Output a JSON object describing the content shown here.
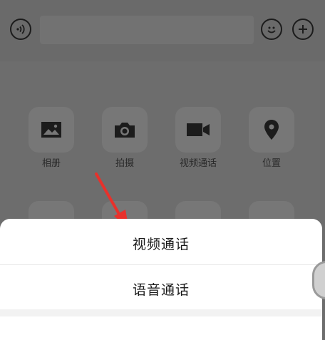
{
  "input_bar": {
    "voice_icon": "voice-icon",
    "emoji_icon": "emoji-icon",
    "plus_icon": "plus-icon"
  },
  "tools": [
    {
      "label": "相册",
      "icon": "image-icon"
    },
    {
      "label": "拍摄",
      "icon": "camera-icon"
    },
    {
      "label": "视频通话",
      "icon": "video-icon"
    },
    {
      "label": "位置",
      "icon": "location-icon"
    }
  ],
  "sheet": {
    "items": [
      {
        "label": "视频通话"
      },
      {
        "label": "语音通话"
      }
    ]
  },
  "colors": {
    "overlay": "#6d6d6d",
    "sheet_bg": "#ffffff",
    "arrow": "#e8312b"
  }
}
